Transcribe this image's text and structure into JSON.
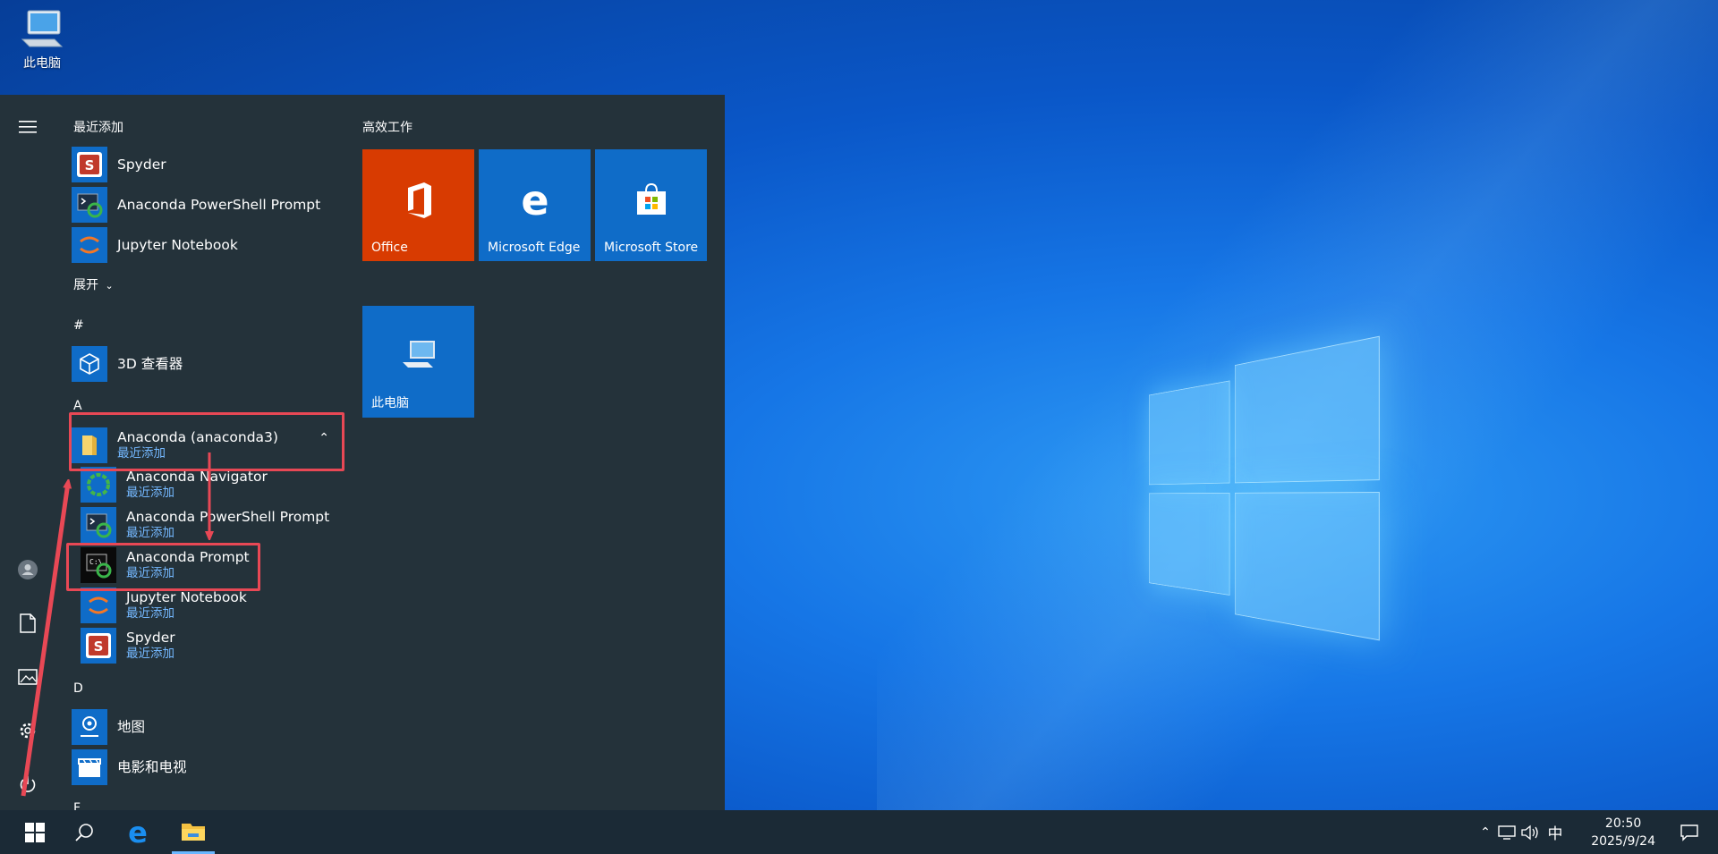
{
  "desktop": {
    "icons": [
      {
        "label": "此电脑",
        "icon": "computer-icon"
      }
    ]
  },
  "start_menu": {
    "recent_header": "最近添加",
    "recent": [
      {
        "label": "Spyder",
        "icon": "spyder-icon"
      },
      {
        "label": "Anaconda PowerShell Prompt",
        "icon": "powershell-prompt-icon"
      },
      {
        "label": "Jupyter Notebook",
        "icon": "jupyter-icon"
      }
    ],
    "expand_label": "展开",
    "groups": [
      {
        "letter": "#",
        "items": [
          {
            "label": "3D 查看器",
            "icon": "3d-viewer-icon"
          }
        ]
      },
      {
        "letter": "A",
        "folder": {
          "label": "Anaconda (anaconda3)",
          "sub": "最近添加",
          "icon": "folder-icon"
        },
        "children": [
          {
            "label": "Anaconda Navigator",
            "sub": "最近添加",
            "icon": "navigator-icon"
          },
          {
            "label": "Anaconda PowerShell Prompt",
            "sub": "最近添加",
            "icon": "powershell-prompt-icon"
          },
          {
            "label": "Anaconda Prompt",
            "sub": "最近添加",
            "icon": "prompt-icon"
          },
          {
            "label": "Jupyter Notebook",
            "sub": "最近添加",
            "icon": "jupyter-icon"
          },
          {
            "label": "Spyder",
            "sub": "最近添加",
            "icon": "spyder-icon"
          }
        ]
      },
      {
        "letter": "D",
        "items": [
          {
            "label": "地图",
            "icon": "maps-icon"
          },
          {
            "label": "电影和电视",
            "icon": "movies-tv-icon"
          }
        ]
      },
      {
        "letter": "F"
      }
    ],
    "tiles_header": "高效工作",
    "tiles": [
      {
        "label": "Office",
        "color": "#d83b01",
        "icon": "office-icon"
      },
      {
        "label": "Microsoft Edge",
        "color": "#0f6cc8",
        "icon": "edge-icon"
      },
      {
        "label": "Microsoft Store",
        "color": "#0f6cc8",
        "icon": "store-icon"
      },
      {
        "label": "此电脑",
        "color": "#0f6cc8",
        "icon": "computer-icon"
      }
    ],
    "rail": [
      "hamburger-icon",
      "user-icon",
      "documents-icon",
      "pictures-icon",
      "settings-icon",
      "power-icon"
    ]
  },
  "taskbar": {
    "pinned": [
      "start-button",
      "search-icon",
      "edge-icon",
      "file-explorer-icon"
    ],
    "tray": {
      "ime": "中",
      "time": "20:50",
      "date": "2025/9/24"
    }
  },
  "colors": {
    "annotation": "#e84855",
    "start_bg": "#24323a",
    "tile_blue": "#0f6cc8",
    "office": "#d83b01"
  }
}
